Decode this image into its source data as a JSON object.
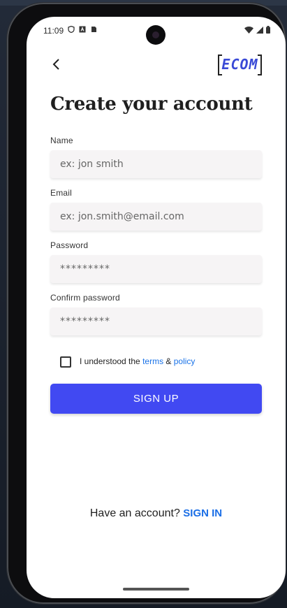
{
  "status_bar": {
    "time": "11:09"
  },
  "logo": {
    "text": "ECOM"
  },
  "page": {
    "title": "Create your account"
  },
  "form": {
    "name": {
      "label": "Name",
      "placeholder": "ex: jon smith"
    },
    "email": {
      "label": "Email",
      "placeholder": "ex: jon.smith@email.com"
    },
    "password": {
      "label": "Password",
      "placeholder": "*********"
    },
    "confirm_password": {
      "label": "Confirm password",
      "placeholder": "*********"
    }
  },
  "terms": {
    "prefix": "I understood the ",
    "terms_link": "terms",
    "ampersand": " & ",
    "policy_link": "policy",
    "checked": false
  },
  "signup_button": {
    "label": "SIGN UP"
  },
  "footer": {
    "prompt": "Have an account? ",
    "signin_link": "SIGN IN"
  },
  "colors": {
    "primary_button": "#4149f2",
    "link": "#1a73e8",
    "logo": "#3a4ad6",
    "input_bg": "#f6f4f5"
  }
}
